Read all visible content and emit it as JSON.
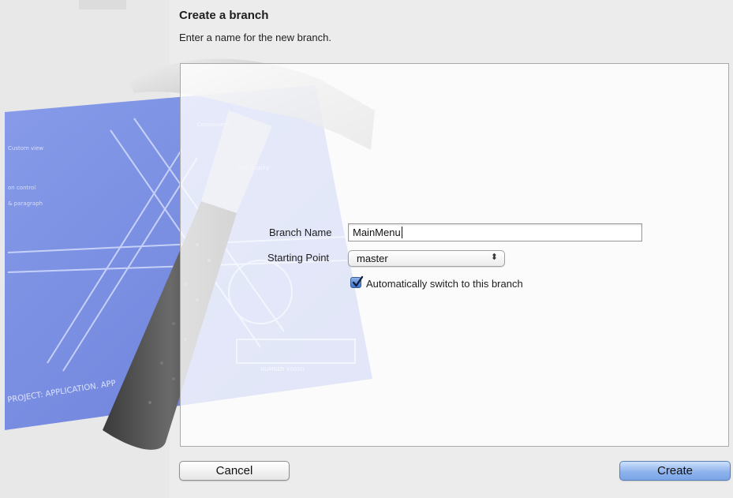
{
  "dialog": {
    "title": "Create a branch",
    "subtitle": "Enter a name for the new branch."
  },
  "form": {
    "branch_name_label": "Branch Name",
    "branch_name_value": "MainMenu",
    "starting_point_label": "Starting Point",
    "starting_point_value": "master",
    "auto_switch_label": "Automatically switch to this branch",
    "auto_switch_checked": true
  },
  "buttons": {
    "cancel_label": "Cancel",
    "create_label": "Create"
  },
  "background": {
    "blueprint_text": "PROJECT: APPLICATION. APP",
    "colors": {
      "blueprint": "#6a82e0",
      "accent": "#7aa5e8"
    }
  }
}
